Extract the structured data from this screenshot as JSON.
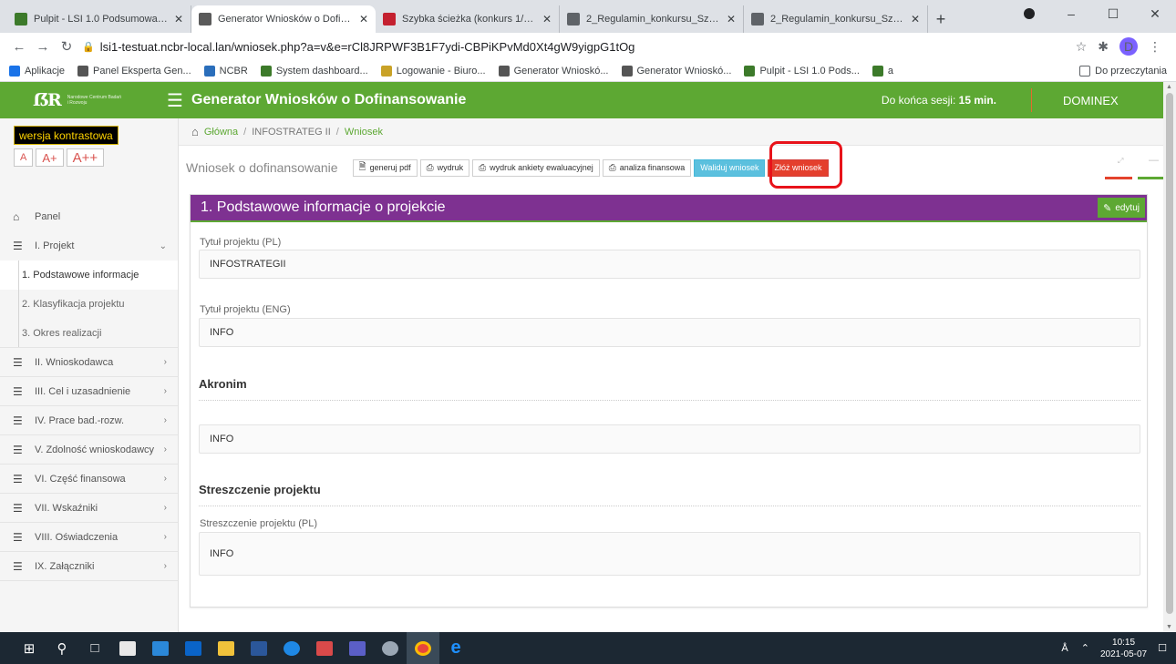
{
  "browser": {
    "tabs": [
      {
        "title": "Pulpit - LSI 1.0 Podsumowanie -",
        "active": false,
        "favicon_color": "#3c7a2a"
      },
      {
        "title": "Generator Wniosków o Dofinans",
        "active": true,
        "favicon_color": "#5a5a5a"
      },
      {
        "title": "Szybka ścieżka (konkurs 1/1.1.1/",
        "active": false,
        "favicon_color": "#c4202f"
      },
      {
        "title": "2_Regulamin_konkursu_Szybka_",
        "active": false,
        "favicon_color": "#5f6368"
      },
      {
        "title": "2_Regulamin_konkursu_Szybka_",
        "active": false,
        "favicon_color": "#5f6368"
      }
    ],
    "new_tab": "+",
    "url": "lsi1-testuat.ncbr-local.lan/wniosek.php?a=v&e=rCl8JRPWF3B1F7ydi-CBPiKPvMd0Xt4gW9yigpG1tOg",
    "profile_initial": "D",
    "bookmarks": [
      {
        "label": "Aplikacje",
        "icon": "apps-grid-icon",
        "color": "#1a73e8"
      },
      {
        "label": "Panel Eksperta Gen...",
        "icon": "ncbr-bird-icon",
        "color": "#555"
      },
      {
        "label": "NCBR",
        "icon": "ncbr-square-icon",
        "color": "#2a6ebb"
      },
      {
        "label": "System dashboard...",
        "icon": "lsi-icon",
        "color": "#3c7a2a"
      },
      {
        "label": "Logowanie - Biuro...",
        "icon": "biuro-icon",
        "color": "#c9a227"
      },
      {
        "label": "Generator Wnioskó...",
        "icon": "ncbr-bird-icon",
        "color": "#555"
      },
      {
        "label": "Generator Wnioskó...",
        "icon": "ncbr-bird-icon",
        "color": "#555"
      },
      {
        "label": "Pulpit - LSI 1.0 Pods...",
        "icon": "lsi-icon",
        "color": "#3c7a2a"
      },
      {
        "label": "a",
        "icon": "lsi-icon",
        "color": "#3c7a2a"
      }
    ],
    "reading_list": "Do przeczytania"
  },
  "app": {
    "title": "Generator Wniosków o Dofinansowanie",
    "logo_text": "Narodowe Centrum Badań i Rozwoju",
    "session_label": "Do końca sesji:",
    "session_value": "15 min.",
    "user": "DOMINEX",
    "colors": {
      "header": "#5da833",
      "panel_header": "#7e3191",
      "accent_red": "#e43f2d",
      "accent_blue": "#5bc0de"
    }
  },
  "sidebar": {
    "contrast_label": "wersja kontrastowa",
    "font_sizes": [
      "A",
      "A+",
      "A++"
    ],
    "panel_label": "Panel",
    "project_label": "I. Projekt",
    "project_subitems": [
      "1. Podstawowe informacje",
      "2. Klasyfikacja projektu",
      "3. Okres realizacji"
    ],
    "sections": [
      "II. Wnioskodawca",
      "III. Cel i uzasadnienie",
      "IV. Prace bad.-rozw.",
      "V. Zdolność wnioskodawcy",
      "VI. Część finansowa",
      "VII. Wskaźniki",
      "VIII. Oświadczenia",
      "IX. Załączniki"
    ]
  },
  "breadcrumb": {
    "home": "Główna",
    "middle": "INFOSTRATEG II",
    "current": "Wniosek"
  },
  "toolbar": {
    "title": "Wniosek o dofinansowanie",
    "btn_pdf": "generuj pdf",
    "btn_print": "wydruk",
    "btn_survey": "wydruk ankiety ewaluacyjnej",
    "btn_finance": "analiza finansowa",
    "btn_validate": "Waliduj wniosek",
    "btn_submit": "Złóż wniosek"
  },
  "panel": {
    "title": "1. Podstawowe informacje o projekcie",
    "edit_label": "edytuj",
    "title_pl_label": "Tytuł projektu (PL)",
    "title_pl_value": "INFOSTRATEGII",
    "title_en_label": "Tytuł projektu (ENG)",
    "title_en_value": "INFO",
    "acronym_header": "Akronim",
    "acronym_value": "INFO",
    "summary_header": "Streszczenie projektu",
    "summary_pl_label": "Streszczenie projektu (PL)",
    "summary_pl_value": "INFO"
  },
  "taskbar": {
    "time": "10:15",
    "date": "2021-05-07"
  }
}
